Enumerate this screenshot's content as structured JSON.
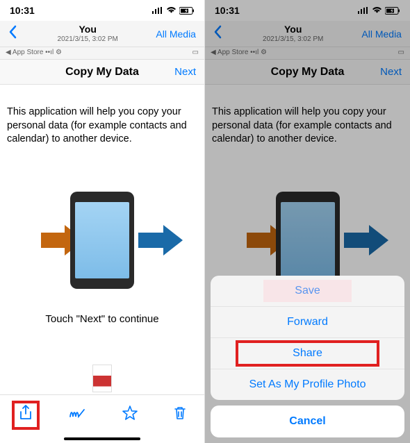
{
  "status": {
    "time": "10:31",
    "indicators": "􀙇 ⚡︎"
  },
  "nav": {
    "title": "You",
    "subtitle": "2021/3/15, 3:02 PM",
    "right": "All Media",
    "appstore": "App Store"
  },
  "page": {
    "title": "Copy My Data",
    "next": "Next"
  },
  "body": {
    "intro": "This application will help you copy your personal data (for example contacts and calendar) to another device.",
    "continue": "Touch \"Next\" to continue"
  },
  "sheet": {
    "save": "Save",
    "forward": "Forward",
    "share": "Share",
    "set_photo": "Set As My Profile Photo",
    "cancel": "Cancel"
  }
}
